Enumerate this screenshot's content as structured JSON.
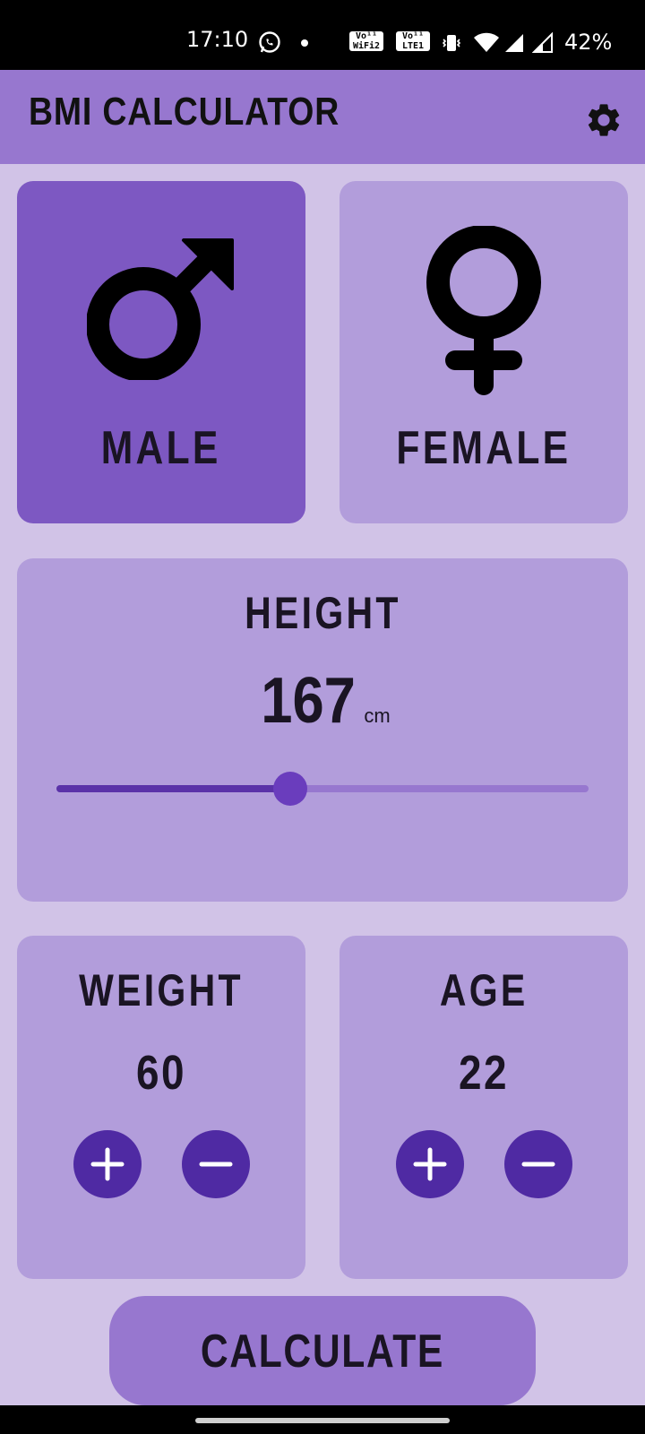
{
  "status_bar": {
    "time": "17:10",
    "battery": "42%",
    "badge_wifi_top": "Vo¹¹",
    "badge_wifi_bottom": "WiFi2",
    "badge_lte_top": "Vo¹¹",
    "badge_lte_bottom": "LTE1"
  },
  "app_bar": {
    "title": "BMI CALCULATOR",
    "settings_icon": "gear-icon"
  },
  "gender": {
    "male": {
      "label": "MALE",
      "icon": "male-symbol-icon",
      "selected": true
    },
    "female": {
      "label": "FEMALE",
      "icon": "female-symbol-icon",
      "selected": false
    }
  },
  "height": {
    "label": "HEIGHT",
    "value": "167",
    "unit": "cm",
    "slider_level": 0.44
  },
  "weight": {
    "label": "WEIGHT",
    "value": "60",
    "plus_icon": "plus-icon",
    "minus_icon": "minus-icon"
  },
  "age": {
    "label": "AGE",
    "value": "22",
    "plus_icon": "plus-icon",
    "minus_icon": "minus-icon"
  },
  "calculate_button": {
    "label": "CALCULATE"
  },
  "colors": {
    "background": "#d1c3e7",
    "app_bar": "#9777cf",
    "card": "#b29ddb",
    "card_selected": "#7d58c2",
    "button_round": "#4f2aa3",
    "slider_active": "#5a32a8"
  }
}
